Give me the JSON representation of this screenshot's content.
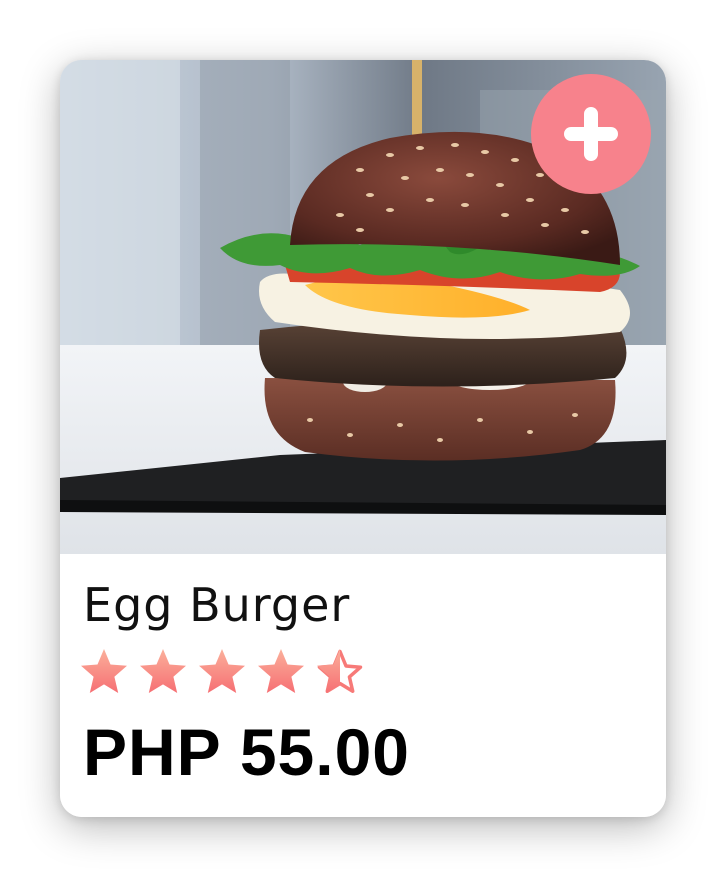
{
  "product": {
    "name": "Egg Burger",
    "price": "PHP 55.00",
    "rating": 4.5,
    "rating_max": 5,
    "image_icon": "burger-photo"
  },
  "actions": {
    "add_icon": "plus-icon"
  },
  "colors": {
    "accent": "#f7828c",
    "star_top": "#fbb09b",
    "star_bottom": "#f66f73",
    "text": "#111111"
  }
}
